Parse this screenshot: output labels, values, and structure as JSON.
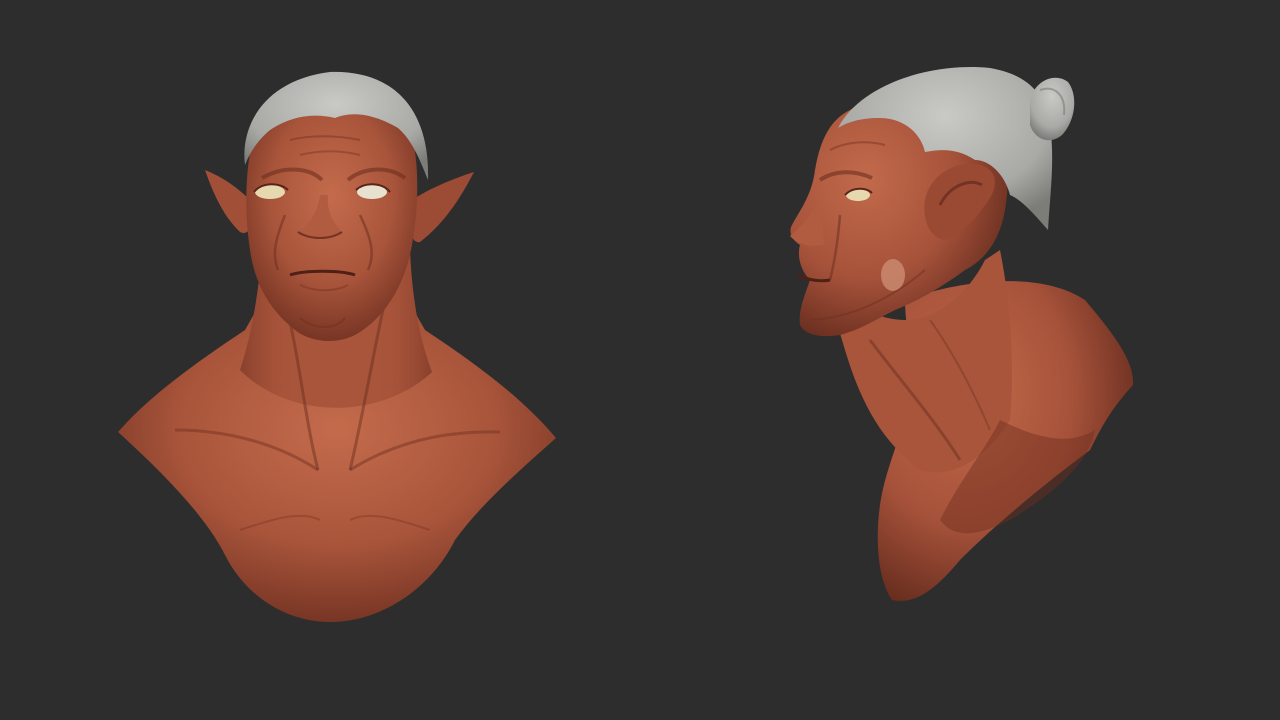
{
  "viewport": {
    "background": "#2d2d2d",
    "models": [
      {
        "name": "bust-front-view",
        "view": "front"
      },
      {
        "name": "bust-side-view",
        "view": "three-quarter-left"
      }
    ]
  },
  "colors": {
    "skin_base": "#a9553b",
    "skin_light": "#c46b4c",
    "skin_shadow": "#6e2f20",
    "skin_deep": "#4f2016",
    "hair_base": "#a9a9a6",
    "hair_light": "#c9c9c5",
    "hair_shadow": "#7c7c78",
    "eye": "#e6d9b0"
  }
}
